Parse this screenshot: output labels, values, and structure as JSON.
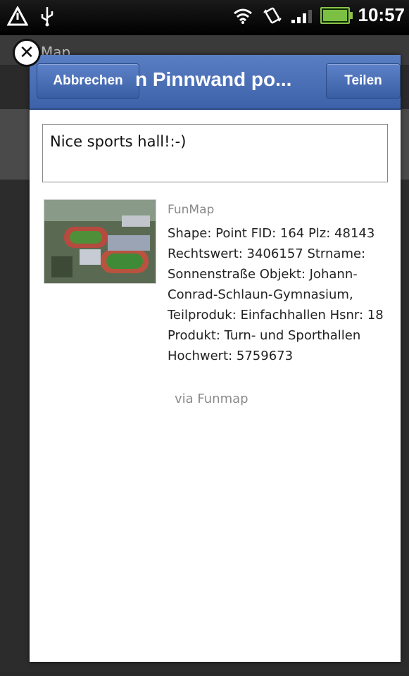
{
  "status_bar": {
    "time": "10:57",
    "icons": [
      "warning-icon",
      "usb-icon",
      "wifi-icon",
      "vibrate-icon",
      "signal-icon",
      "battery-icon"
    ]
  },
  "background_app": {
    "title": "Map"
  },
  "dialog": {
    "title": "n Pinnwand po...",
    "cancel_label": "Abbrechen",
    "share_label": "Teilen",
    "message_value": "Nice sports hall!:-)",
    "link": {
      "source": "FunMap",
      "description": "Shape: Point FID: 164 Plz: 48143 Rechtswert: 3406157 Strname: Sonnenstraße Objekt: Johann-Conrad-Schlaun-Gymnasium, Teilproduk: Einfachhallen Hsnr: 18 Produkt: Turn- und Sporthallen Hochwert: 5759673",
      "via": "via Funmap"
    }
  },
  "colors": {
    "header_blue": "#4a6fb5",
    "dialog_bg": "#ffffff"
  }
}
